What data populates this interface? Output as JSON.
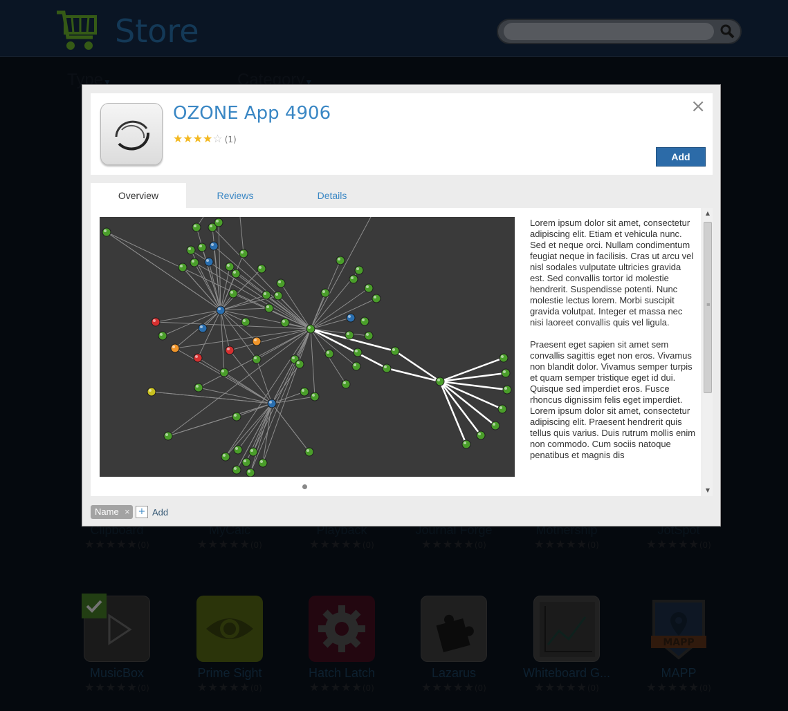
{
  "store": {
    "title": "Store",
    "search_placeholder": "",
    "filters": {
      "type_label": "Type",
      "category_label": "Category"
    }
  },
  "background_widgets_row1": [
    {
      "name": "Clipboard",
      "rating_count": "(0)"
    },
    {
      "name": "MyCalc",
      "rating_count": "(0)"
    },
    {
      "name": "Playback",
      "rating_count": "(0)"
    },
    {
      "name": "Journal Forge",
      "rating_count": "(0)"
    },
    {
      "name": "Mothership",
      "rating_count": "(0)"
    },
    {
      "name": "JotSpot",
      "rating_count": "(0)"
    }
  ],
  "background_widgets_row2": [
    {
      "name": "MusicBox",
      "rating_count": "(0)",
      "icon": "play-icon"
    },
    {
      "name": "Prime Sight",
      "rating_count": "(0)",
      "icon": "eye-icon"
    },
    {
      "name": "Hatch Latch",
      "rating_count": "(0)",
      "icon": "gear-icon"
    },
    {
      "name": "Lazarus",
      "rating_count": "(0)",
      "icon": "puzzle-icon"
    },
    {
      "name": "Whiteboard G...",
      "rating_count": "(0)",
      "icon": "line-chart-icon"
    },
    {
      "name": "MAPP",
      "rating_count": "(0)",
      "icon": "map-pin-icon",
      "badge_text": "MAPP"
    }
  ],
  "modal": {
    "title": "OZONE App 4906",
    "rating_value": 4,
    "rating_max": 5,
    "rating_count": "(1)",
    "add_label": "Add",
    "close_label": "×",
    "tabs": [
      {
        "label": "Overview",
        "active": true
      },
      {
        "label": "Reviews",
        "active": false
      },
      {
        "label": "Details",
        "active": false
      }
    ],
    "description": [
      "Lorem ipsum dolor sit amet, consectetur adipiscing elit. Etiam et vehicula nunc. Sed et neque orci. Nullam condimentum feugiat neque in facilisis. Cras ut arcu vel nisl sodales vulputate ultricies gravida est. Sed convallis tortor id molestie hendrerit. Suspendisse potenti. Nunc molestie lectus lorem. Morbi suscipit gravida volutpat. Integer et massa nec nisi laoreet convallis quis vel ligula.",
      "Praesent eget sapien sit amet sem convallis sagittis eget non eros. Vivamus non blandit dolor. Vivamus semper turpis et quam semper tristique eget id dui. Quisque sed imperdiet eros. Fusce rhoncus dignissim felis eget imperdiet. Lorem ipsum dolor sit amet, consectetur adipiscing elit. Praesent hendrerit quis tellus quis varius. Duis rutrum mollis enim non commodo. Cum sociis natoque penatibus et magnis dis"
    ],
    "tags": [
      {
        "label": "Name",
        "remove_label": "×"
      }
    ],
    "tag_add_symbol": "+",
    "tag_add_label": "Add"
  },
  "colors": {
    "accent": "#3a87c4",
    "add_button": "#2c6ba8",
    "star": "#f3b81f",
    "node_green": "#4a9e2a",
    "node_blue": "#2a6fb0",
    "node_red": "#d63030",
    "node_orange": "#f0952a",
    "node_yellow": "#c8c020"
  }
}
